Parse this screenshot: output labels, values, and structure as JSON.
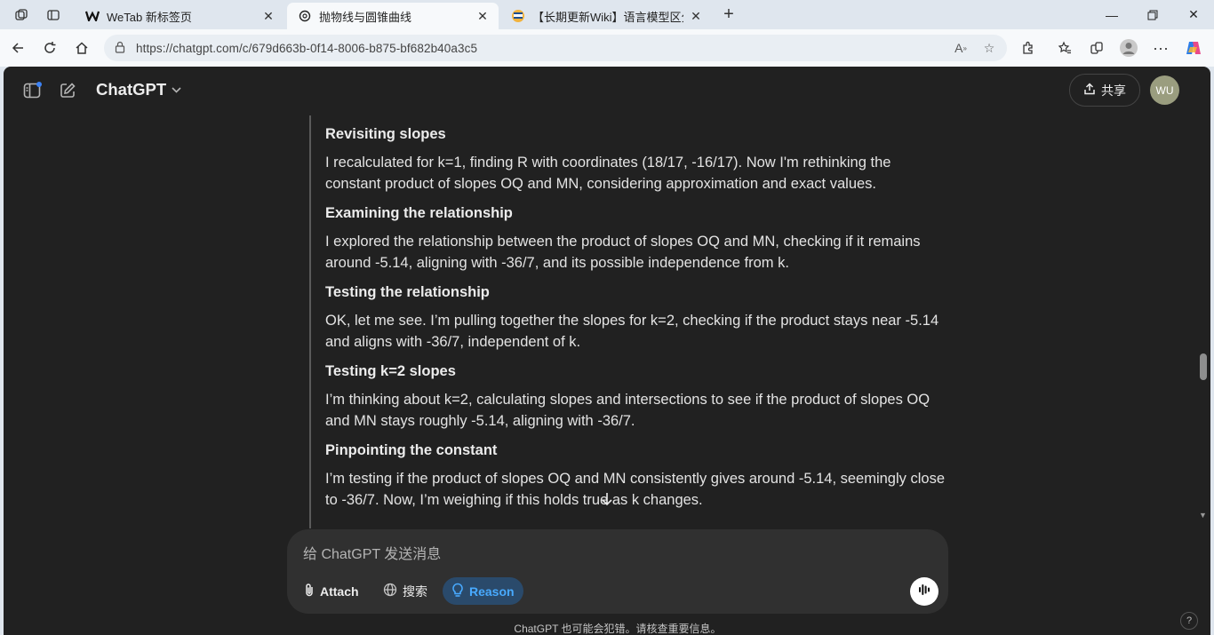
{
  "browser": {
    "tabs": [
      {
        "title": "WeTab 新标签页",
        "favicon": "wetab-icon",
        "active": false
      },
      {
        "title": "抛物线与圆锥曲线",
        "favicon": "chatgpt-icon",
        "active": true
      },
      {
        "title": "【长期更新Wiki】语言模型区分是",
        "favicon": "wiki-icon",
        "active": false
      }
    ],
    "url": "https://chatgpt.com/c/679d663b-0f14-8006-b875-bf682b40a3c5"
  },
  "app": {
    "brand": "ChatGPT",
    "share_label": "共享",
    "avatar_initials": "WU"
  },
  "steps": [
    {
      "title": "Revisiting slopes",
      "text": "I recalculated for k=1, finding R with coordinates (18/17, -16/17). Now I'm rethinking the constant product of slopes OQ and MN, considering approximation and exact values."
    },
    {
      "title": "Examining the relationship",
      "text": "I explored the relationship between the product of slopes OQ and MN, checking if it remains around -5.14, aligning with -36/7, and its possible independence from k."
    },
    {
      "title": "Testing the relationship",
      "text": "OK, let me see. I’m pulling together the slopes for k=2, checking if the product stays near -5.14 and aligns with -36/7, independent of k."
    },
    {
      "title": "Testing k=2 slopes",
      "text": "I’m thinking about k=2, calculating slopes and intersections to see if the product of slopes OQ and MN stays roughly -5.14, aligning with -36/7."
    },
    {
      "title": "Pinpointing the constant",
      "text": "I’m testing if the product of slopes OQ and MN consistently gives around -5.14, seemingly close to -36/7. Now, I’m weighing if this holds true as k changes."
    }
  ],
  "composer": {
    "placeholder": "给 ChatGPT 发送消息",
    "attach_label": "Attach",
    "search_label": "搜索",
    "reason_label": "Reason"
  },
  "footer": {
    "disclaimer": "ChatGPT 也可能会犯错。请核查重要信息。",
    "help": "?"
  },
  "colors": {
    "app_bg": "#212121",
    "composer_bg": "#303030",
    "reason_accent": "#48aaff"
  }
}
